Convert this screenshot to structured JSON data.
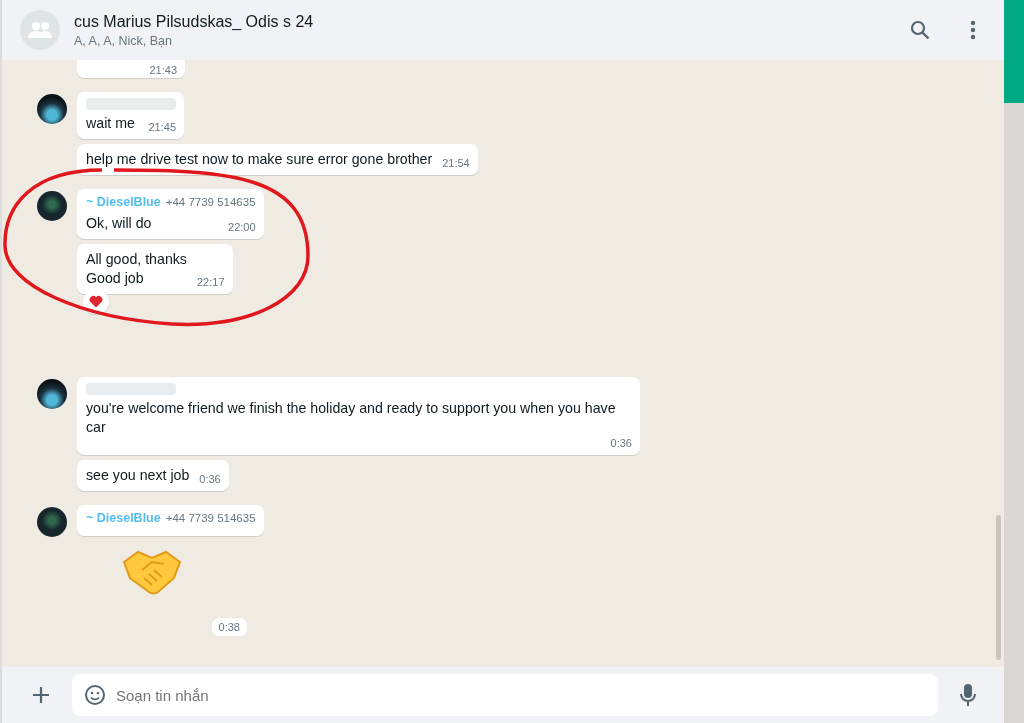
{
  "header": {
    "title": "cus Marius Pilsudskas_ Odis s 24",
    "subtitle": "A, A, A, Nick, Bạn"
  },
  "messages": [
    {
      "kind": "cut",
      "avatar": false,
      "time": "21:43"
    },
    {
      "kind": "text",
      "avatar": true,
      "lines": [
        "wait me"
      ],
      "time": "21:45",
      "blurred_name": true
    },
    {
      "kind": "text",
      "avatar": false,
      "lines": [
        "help me drive test now to make sure error gone brother"
      ],
      "time": "21:54"
    },
    {
      "kind": "text",
      "avatar": true,
      "sender": "~ DieselBlue",
      "phone": "+44 7739 514635",
      "lines": [
        "Ok, will do"
      ],
      "time": "22:00"
    },
    {
      "kind": "text",
      "avatar": false,
      "lines": [
        "All good, thanks",
        "Good job"
      ],
      "time": "22:17",
      "reacted": true
    },
    {
      "kind": "text",
      "avatar": true,
      "lines": [
        "you're welcome friend we finish the holiday and ready to support you when you have car"
      ],
      "time": "0:36",
      "blurred_name": true
    },
    {
      "kind": "text",
      "avatar": false,
      "lines": [
        "see you next job"
      ],
      "time": "0:36"
    },
    {
      "kind": "text",
      "avatar": true,
      "sender": "~ DieselBlue",
      "phone": "+44 7739 514635"
    },
    {
      "kind": "sticker",
      "avatar": false,
      "time": "0:38"
    }
  ],
  "composer": {
    "placeholder": "Soạn tin nhắn"
  }
}
